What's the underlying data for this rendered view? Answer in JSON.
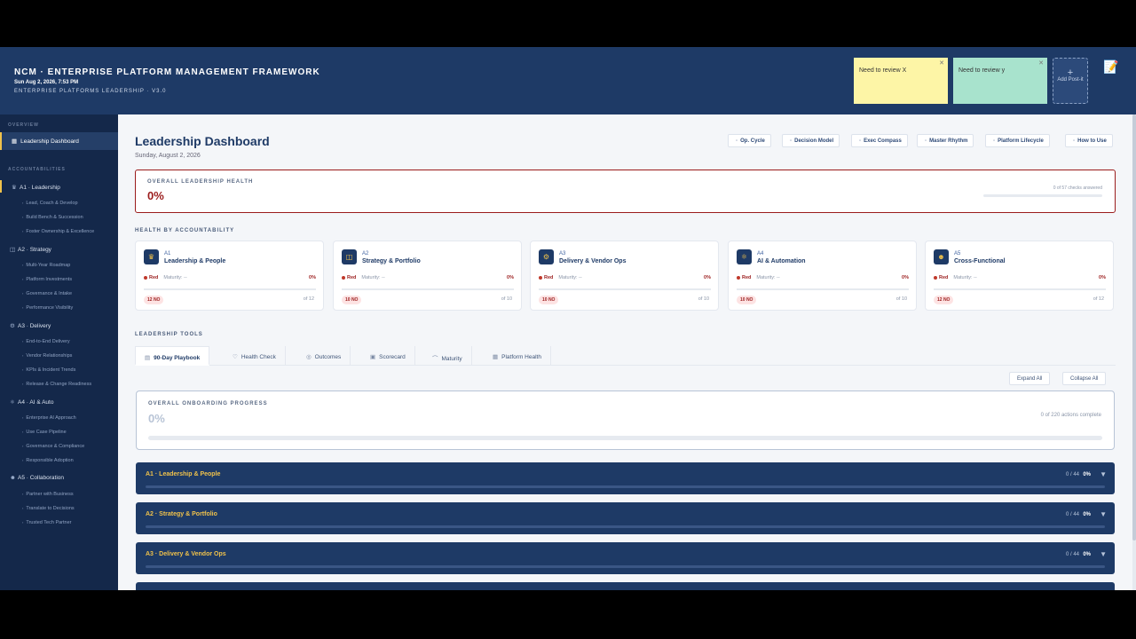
{
  "header": {
    "title": "NCM · ENTERPRISE PLATFORM MANAGEMENT FRAMEWORK",
    "date": "Sun Aug 2, 2026, 7:53 PM",
    "subtitle": "ENTERPRISE PLATFORMS LEADERSHIP · V3.0",
    "postits": [
      {
        "text": "Need to review X",
        "color": "#fdf5a6"
      },
      {
        "text": "Need to review y",
        "color": "#a8e3cd"
      }
    ],
    "add_postit": "Add Post-it",
    "note_icon": "notepad-icon"
  },
  "sidebar": {
    "overview_label": "OVERVIEW",
    "active_item": "Leadership Dashboard",
    "accountabilities_label": "ACCOUNTABILITIES",
    "groups": [
      {
        "label": "A1 · Leadership",
        "icon": "crown-icon",
        "items": [
          "Lead, Coach & Develop",
          "Build Bench & Succession",
          "Foster Ownership & Excellence"
        ]
      },
      {
        "label": "A2 · Strategy",
        "icon": "chart-icon",
        "items": [
          "Multi-Year Roadmap",
          "Platform Investments",
          "Governance & Intake",
          "Performance Visibility"
        ]
      },
      {
        "label": "A3 · Delivery",
        "icon": "gear-icon",
        "items": [
          "End-to-End Delivery",
          "Vendor Relationships",
          "KPIs & Incident Trends",
          "Release & Change Readiness"
        ]
      },
      {
        "label": "A4 · AI & Auto",
        "icon": "robot-icon",
        "items": [
          "Enterprise AI Approach",
          "Use Case Pipeline",
          "Governance & Compliance",
          "Responsible Adoption"
        ]
      },
      {
        "label": "A5 · Collaboration",
        "icon": "people-icon",
        "items": [
          "Partner with Business",
          "Translate to Decisions",
          "Trusted Tech Partner"
        ]
      }
    ]
  },
  "main": {
    "title": "Leadership Dashboard",
    "date": "Sunday, August 2, 2026",
    "quick_buttons": [
      "Op. Cycle",
      "Decision Model",
      "Exec Compass",
      "Master Rhythm",
      "Platform Lifecycle",
      "How to Use"
    ],
    "health": {
      "label": "OVERALL LEADERSHIP HEALTH",
      "value": "0%",
      "count": "0 of 57 checks answered",
      "progress": 0
    },
    "by_accountability_label": "HEALTH BY ACCOUNTABILITY",
    "cards": [
      {
        "code": "A1",
        "name": "Leadership & People",
        "status": "Red",
        "maturity": "Maturity: --",
        "pct": "0%",
        "no_badge": "12 NO",
        "of": "of 12",
        "icon": "crown-icon"
      },
      {
        "code": "A2",
        "name": "Strategy & Portfolio",
        "status": "Red",
        "maturity": "Maturity: --",
        "pct": "0%",
        "no_badge": "10 NO",
        "of": "of 10",
        "icon": "chart-icon"
      },
      {
        "code": "A3",
        "name": "Delivery & Vendor Ops",
        "status": "Red",
        "maturity": "Maturity: --",
        "pct": "0%",
        "no_badge": "10 NO",
        "of": "of 10",
        "icon": "gear-icon"
      },
      {
        "code": "A4",
        "name": "AI & Automation",
        "status": "Red",
        "maturity": "Maturity: --",
        "pct": "0%",
        "no_badge": "10 NO",
        "of": "of 10",
        "icon": "robot-icon"
      },
      {
        "code": "A5",
        "name": "Cross-Functional",
        "status": "Red",
        "maturity": "Maturity: --",
        "pct": "0%",
        "no_badge": "12 NO",
        "of": "of 12",
        "icon": "people-icon"
      }
    ],
    "tools_label": "LEADERSHIP TOOLS",
    "tabs": [
      {
        "label": "90-Day Playbook",
        "icon": "book-icon"
      },
      {
        "label": "Health Check",
        "icon": "pulse-icon"
      },
      {
        "label": "Outcomes",
        "icon": "target-icon"
      },
      {
        "label": "Scorecard",
        "icon": "scorecard-icon"
      },
      {
        "label": "Maturity",
        "icon": "trend-icon"
      },
      {
        "label": "Platform Health",
        "icon": "grid-icon"
      }
    ],
    "expand_all": "Expand All",
    "collapse_all": "Collapse All",
    "onboarding": {
      "label": "OVERALL ONBOARDING PROGRESS",
      "value": "0%",
      "count": "0 of 220 actions complete",
      "progress": 0
    },
    "accordions": [
      {
        "title": "A1 · Leadership & People",
        "count": "0 / 44",
        "pct": "0%"
      },
      {
        "title": "A2 · Strategy & Portfolio",
        "count": "0 / 44",
        "pct": "0%"
      },
      {
        "title": "A3 · Delivery & Vendor Ops",
        "count": "0 / 44",
        "pct": "0%"
      }
    ]
  },
  "colors": {
    "header": "#1e3a66",
    "sidebar": "#14284a",
    "accent": "#f0c24b",
    "danger": "#9b1c1c"
  }
}
